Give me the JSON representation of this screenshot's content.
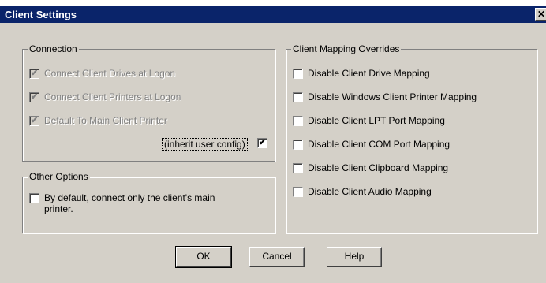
{
  "window": {
    "title": "Client Settings",
    "close_glyph": "✕"
  },
  "connection": {
    "title": "Connection",
    "items": [
      {
        "label": "Connect Client Drives at Logon",
        "checked": true
      },
      {
        "label": "Connect Client Printers at Logon",
        "checked": true
      },
      {
        "label": "Default To Main Client Printer",
        "checked": true
      }
    ],
    "inherit_label": "(inherit user config)",
    "inherit_checked": true
  },
  "other_options": {
    "title": "Other Options",
    "item_line1": "By default, connect only the client's main",
    "item_line2": "printer."
  },
  "mapping": {
    "title": "Client Mapping Overrides",
    "items": [
      "Disable Client Drive Mapping",
      "Disable Windows Client Printer Mapping",
      "Disable Client LPT Port Mapping",
      "Disable Client COM Port Mapping",
      "Disable Client Clipboard Mapping",
      "Disable Client Audio Mapping"
    ]
  },
  "buttons": {
    "ok": "OK",
    "cancel": "Cancel",
    "help": "Help"
  },
  "check_glyph": "✔"
}
